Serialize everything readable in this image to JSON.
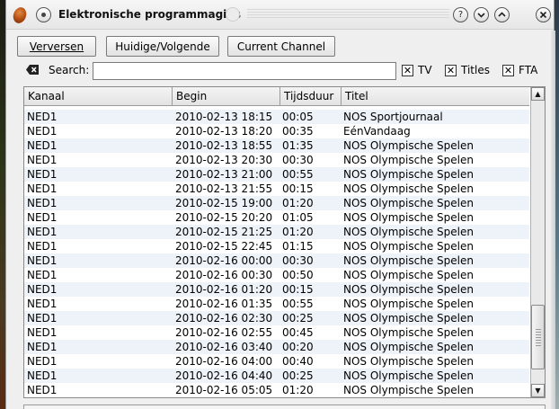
{
  "window": {
    "title": "Elektronische programmagids"
  },
  "toolbar": {
    "refresh_label": "Verversen",
    "current_next_label": "Huidige/Volgende",
    "current_channel_label": "Current Channel"
  },
  "search": {
    "label": "Search:",
    "value": ""
  },
  "filters": [
    {
      "label": "TV",
      "checked": true
    },
    {
      "label": "Titles",
      "checked": true
    },
    {
      "label": "FTA",
      "checked": true
    }
  ],
  "table": {
    "columns": [
      "Kanaal",
      "Begin",
      "Tijdsduur",
      "Titel"
    ],
    "rows": [
      [
        "NED1",
        "2010-02-13 18:15",
        "00:05",
        "NOS Sportjournaal"
      ],
      [
        "NED1",
        "2010-02-13 18:20",
        "00:35",
        "EénVandaag"
      ],
      [
        "NED1",
        "2010-02-13 18:55",
        "01:35",
        "NOS Olympische Spelen"
      ],
      [
        "NED1",
        "2010-02-13 20:30",
        "00:30",
        "NOS Olympische Spelen"
      ],
      [
        "NED1",
        "2010-02-13 21:00",
        "00:55",
        "NOS Olympische Spelen"
      ],
      [
        "NED1",
        "2010-02-13 21:55",
        "00:15",
        "NOS Olympische Spelen"
      ],
      [
        "NED1",
        "2010-02-15 19:00",
        "01:20",
        "NOS Olympische Spelen"
      ],
      [
        "NED1",
        "2010-02-15 20:20",
        "01:05",
        "NOS Olympische Spelen"
      ],
      [
        "NED1",
        "2010-02-15 21:25",
        "01:20",
        "NOS Olympische Spelen"
      ],
      [
        "NED1",
        "2010-02-15 22:45",
        "01:15",
        "NOS Olympische Spelen"
      ],
      [
        "NED1",
        "2010-02-16 00:00",
        "00:30",
        "NOS Olympische Spelen"
      ],
      [
        "NED1",
        "2010-02-16 00:30",
        "00:50",
        "NOS Olympische Spelen"
      ],
      [
        "NED1",
        "2010-02-16 01:20",
        "00:15",
        "NOS Olympische Spelen"
      ],
      [
        "NED1",
        "2010-02-16 01:35",
        "00:55",
        "NOS Olympische Spelen"
      ],
      [
        "NED1",
        "2010-02-16 02:30",
        "00:25",
        "NOS Olympische Spelen"
      ],
      [
        "NED1",
        "2010-02-16 02:55",
        "00:45",
        "NOS Olympische Spelen"
      ],
      [
        "NED1",
        "2010-02-16 03:40",
        "00:20",
        "NOS Olympische Spelen"
      ],
      [
        "NED1",
        "2010-02-16 04:00",
        "00:40",
        "NOS Olympische Spelen"
      ],
      [
        "NED1",
        "2010-02-16 04:40",
        "00:25",
        "NOS Olympische Spelen"
      ],
      [
        "NED1",
        "2010-02-16 05:05",
        "01:20",
        "NOS Olympische Spelen"
      ]
    ]
  },
  "icons": {
    "app": "flame-app-icon",
    "help": "help-icon",
    "minimize": "minimize-icon",
    "maximize": "maximize-icon",
    "close": "close-icon",
    "search": "search-clear-icon"
  }
}
